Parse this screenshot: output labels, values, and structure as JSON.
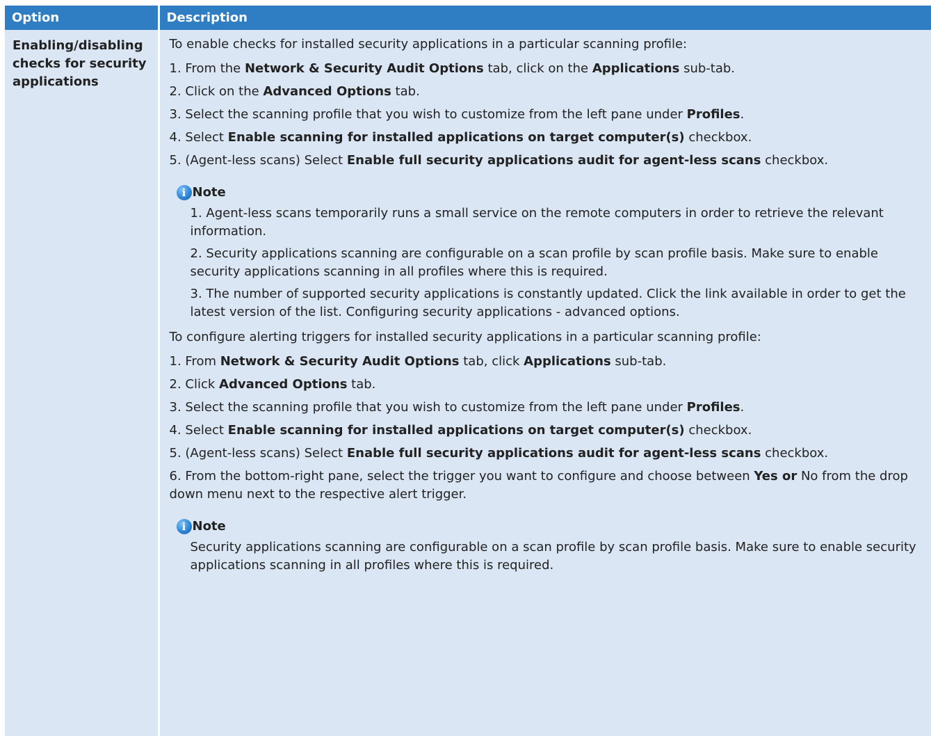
{
  "table": {
    "headers": {
      "option": "Option",
      "description": "Description"
    },
    "option": "Enabling/disabling checks for security applications",
    "sections": [
      {
        "intro": "To enable checks for installed security applications in a particular scanning profile:",
        "steps": [
          [
            "1. From the ",
            {
              "b": "Network & Security Audit Options"
            },
            " tab, click on the ",
            {
              "b": "Applications"
            },
            " sub-tab."
          ],
          [
            "2. Click on the ",
            {
              "b": "Advanced Options"
            },
            " tab."
          ],
          [
            "3. Select the scanning profile that you wish to customize from the left pane under ",
            {
              "b": "Profiles"
            },
            "."
          ],
          [
            "4. Select ",
            {
              "b": "Enable scanning for installed applications on target computer(s)"
            },
            " checkbox."
          ],
          [
            "5. (Agent-less scans) Select ",
            {
              "b": "Enable full security applications audit for agent-less scans"
            },
            " checkbox."
          ]
        ],
        "note": {
          "title": "Note",
          "items": [
            "1. Agent-less scans temporarily runs a small service on the remote computers in order to retrieve the relevant information.",
            "2. Security applications scanning are configurable on a scan profile by scan profile basis. Make sure to enable security applications scanning in all profiles where this is required.",
            "3. The number of supported security applications is constantly updated. Click the link available in order to get the latest version of the list. Configuring security applications - advanced options."
          ]
        }
      },
      {
        "intro": "To configure alerting triggers for installed security applications in a particular scanning profile:",
        "steps": [
          [
            "1. From ",
            {
              "b": "Network & Security Audit Options"
            },
            " tab, click ",
            {
              "b": "Applications"
            },
            " sub-tab."
          ],
          [
            "2. Click ",
            {
              "b": "Advanced Options"
            },
            " tab."
          ],
          [
            "3. Select the scanning profile that you wish to customize from the left pane under ",
            {
              "b": "Profiles"
            },
            "."
          ],
          [
            "4. Select ",
            {
              "b": "Enable scanning for installed applications on target computer(s)"
            },
            " checkbox."
          ],
          [
            "5. (Agent-less scans) Select ",
            {
              "b": "Enable full security applications audit for agent-less scans"
            },
            " checkbox."
          ],
          [
            "6. From the bottom-right pane, select the trigger you want to configure and choose between ",
            {
              "b": "Yes or"
            },
            " No from the drop down menu next to the respective alert trigger."
          ]
        ],
        "note": {
          "title": "Note",
          "items": [
            "Security applications scanning are configurable on a scan profile by scan profile basis. Make sure to enable security applications scanning in all profiles where this is required."
          ]
        }
      }
    ]
  },
  "icons": {
    "note_icon": "info-icon",
    "note_icon_color": "#2f86d6"
  },
  "colors": {
    "header_bg": "#2f7ec4",
    "cell_bg": "#dae6f3",
    "header_text": "#ffffff"
  }
}
